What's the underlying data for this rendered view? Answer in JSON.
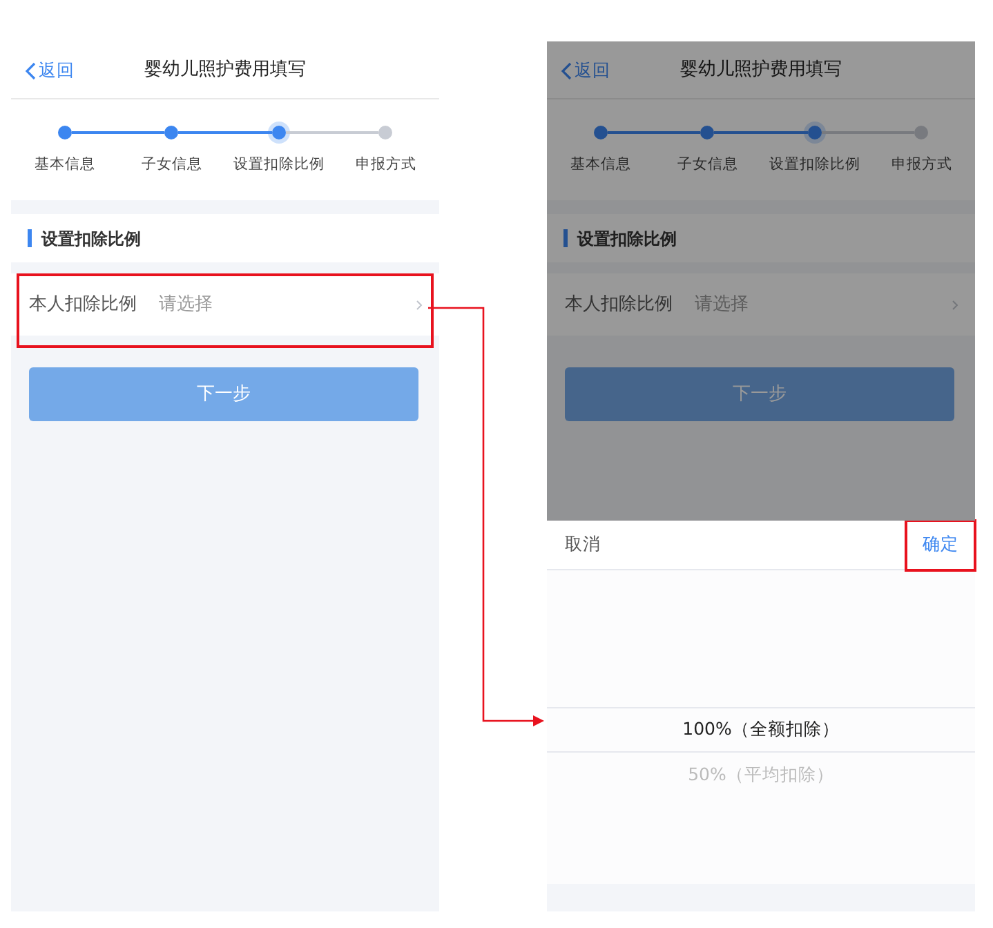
{
  "screens": [
    {
      "dimmed": false,
      "header": {
        "back": "返回",
        "title": "婴幼儿照护费用填写"
      },
      "steps": [
        {
          "label": "基本信息",
          "done": true,
          "selected": false
        },
        {
          "label": "子女信息",
          "done": true,
          "selected": false
        },
        {
          "label": "设置扣除比例",
          "done": true,
          "selected": true
        },
        {
          "label": "申报方式",
          "done": false,
          "selected": false
        }
      ],
      "section_title": "设置扣除比例",
      "field": {
        "label": "本人扣除比例",
        "placeholder": "请选择",
        "highlighted": true
      },
      "next_button": {
        "label": "下一步",
        "disabled": true
      }
    },
    {
      "dimmed": true,
      "header": {
        "back": "返回",
        "title": "婴幼儿照护费用填写"
      },
      "steps": [
        {
          "label": "基本信息",
          "done": true,
          "selected": false
        },
        {
          "label": "子女信息",
          "done": true,
          "selected": false
        },
        {
          "label": "设置扣除比例",
          "done": true,
          "selected": true
        },
        {
          "label": "申报方式",
          "done": false,
          "selected": false
        }
      ],
      "section_title": "设置扣除比例",
      "field": {
        "label": "本人扣除比例",
        "placeholder": "请选择",
        "highlighted": false
      },
      "next_button": {
        "label": "下一步",
        "disabled": true
      },
      "picker": {
        "cancel": "取消",
        "confirm": {
          "label": "确定",
          "highlighted": true
        },
        "options": [
          {
            "label": "100%（全额扣除）",
            "selected": true
          },
          {
            "label": "50%（平均扣除）",
            "selected": false
          }
        ]
      }
    }
  ]
}
